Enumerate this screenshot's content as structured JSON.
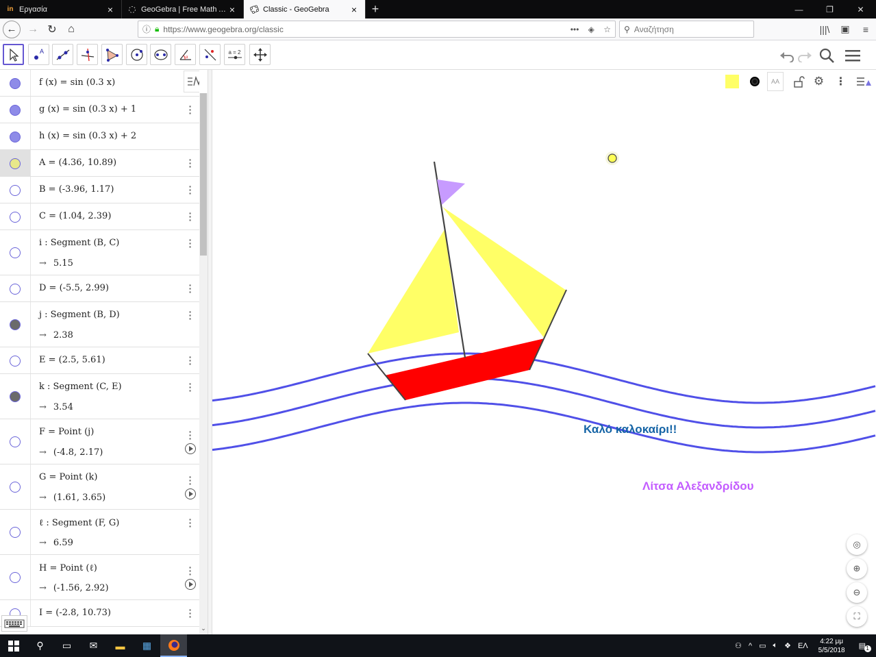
{
  "browser": {
    "tabs": [
      {
        "favicon": "in",
        "title": "Εργασία",
        "active": false
      },
      {
        "favicon": "",
        "title": "GeoGebra | Free Math Apps - us",
        "active": false
      },
      {
        "favicon": "",
        "title": "Classic - GeoGebra",
        "active": true
      }
    ],
    "url": "https://www.geogebra.org/classic",
    "search_placeholder": "Αναζήτηση"
  },
  "toolbar": {
    "tools": [
      "move-tool",
      "point-tool",
      "line-tool",
      "perpendicular-tool",
      "polygon-tool",
      "circle-tool",
      "conic-tool",
      "angle-tool",
      "reflect-tool",
      "slider-tool",
      "move-graphics-tool"
    ],
    "slider_label": "a = 2"
  },
  "algebra": {
    "rows": [
      {
        "def": "f (x)  =  sin (0.3 x)",
        "out": "",
        "marble": "#8e8be8",
        "menu": false,
        "play": false,
        "selected": false
      },
      {
        "def": "g (x)  =  sin (0.3 x) + 1",
        "out": "",
        "marble": "#8e8be8",
        "menu": true,
        "play": false,
        "selected": false
      },
      {
        "def": "h (x)  =  sin (0.3 x) + 2",
        "out": "",
        "marble": "#8e8be8",
        "menu": false,
        "play": false,
        "selected": false
      },
      {
        "def": "A  =  (4.36, 10.89)",
        "out": "",
        "marble": "#e8e88a",
        "menu": true,
        "play": false,
        "selected": true
      },
      {
        "def": "B  =  (-3.96, 1.17)",
        "out": "",
        "marble": "#ffffff",
        "menu": true,
        "play": false,
        "selected": false
      },
      {
        "def": "C  =  (1.04, 2.39)",
        "out": "",
        "marble": "#ffffff",
        "menu": true,
        "play": false,
        "selected": false
      },
      {
        "def": "i : Segment (B, C)",
        "out": "5.15",
        "marble": "#ffffff",
        "menu": true,
        "play": false,
        "selected": false
      },
      {
        "def": "D  =  (-5.5, 2.99)",
        "out": "",
        "marble": "#ffffff",
        "menu": true,
        "play": false,
        "selected": false
      },
      {
        "def": "j : Segment (B, D)",
        "out": "2.38",
        "marble": "#6b6b6b",
        "menu": true,
        "play": false,
        "selected": false
      },
      {
        "def": "E  =  (2.5, 5.61)",
        "out": "",
        "marble": "#ffffff",
        "menu": true,
        "play": false,
        "selected": false
      },
      {
        "def": "k : Segment (C, E)",
        "out": "3.54",
        "marble": "#6b6b6b",
        "menu": true,
        "play": false,
        "selected": false
      },
      {
        "def": "F  =  Point (j)",
        "out": "(-4.8, 2.17)",
        "marble": "#ffffff",
        "menu": true,
        "play": true,
        "selected": false
      },
      {
        "def": "G  =  Point (k)",
        "out": "(1.61, 3.65)",
        "marble": "#ffffff",
        "menu": true,
        "play": true,
        "selected": false
      },
      {
        "def": "ℓ : Segment (F, G)",
        "out": "6.59",
        "marble": "#ffffff",
        "menu": true,
        "play": false,
        "selected": false
      },
      {
        "def": "H  =  Point (ℓ)",
        "out": "(-1.56, 2.92)",
        "marble": "#ffffff",
        "menu": true,
        "play": true,
        "selected": false
      },
      {
        "def": "I  =  (-2.8, 10.73)",
        "out": "",
        "marble": "#ffffff",
        "menu": true,
        "play": false,
        "selected": false
      }
    ]
  },
  "graphics": {
    "greeting": "Καλό καλοκαίρι!!",
    "author": "Λίτσα Αλεξανδρίδου",
    "colors": {
      "curve": "#5050e8",
      "sail": "#ffff66",
      "hull": "#ff0000",
      "flag": "#c79bff",
      "mast": "#444444"
    }
  },
  "taskbar": {
    "lang": "ΕΛ",
    "time": "4:22 μμ",
    "date": "5/5/2018",
    "notifications": "1"
  }
}
